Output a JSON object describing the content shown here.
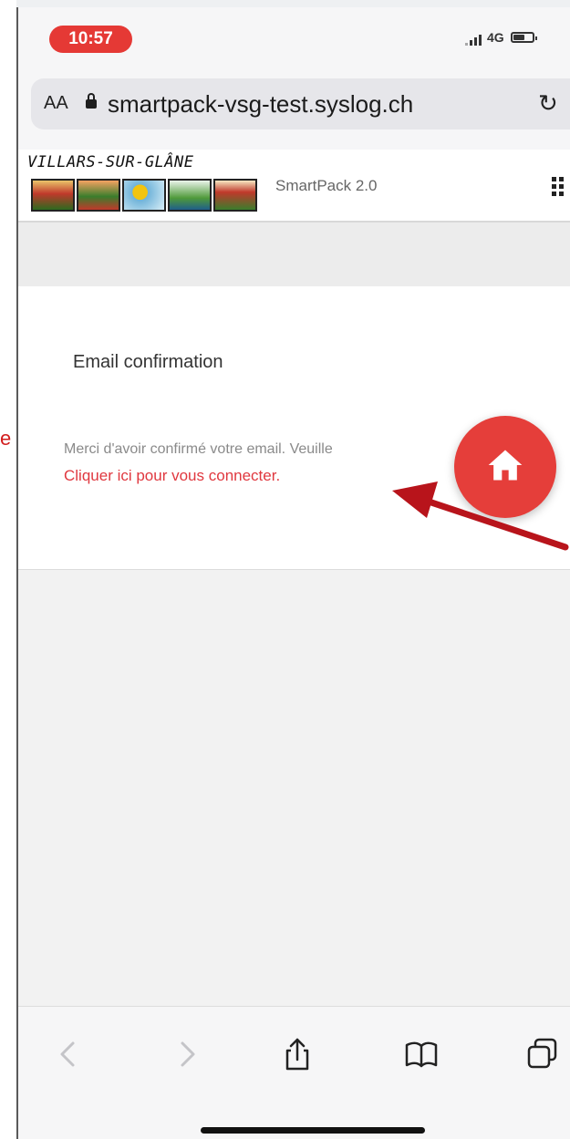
{
  "status_bar": {
    "time": "10:57",
    "network": "4G"
  },
  "address_bar": {
    "text_size_label": "AA",
    "url": "smartpack-vsg-test.syslog.ch"
  },
  "site_header": {
    "logo_text": "VILLARS-SUR-GLÂNE",
    "brand": "SmartPack 2.0"
  },
  "card": {
    "title": "Email confirmation",
    "message": "Merci d'avoir confirmé votre email. Veuille",
    "login_link": "Cliquer ici pour vous connecter."
  },
  "margin_glyph": "e",
  "colors": {
    "accent_red": "#e53e3a",
    "link_red": "#e0383f",
    "annotation_arrow": "#b8141b"
  },
  "icons": {
    "reload": "reload-icon",
    "lock": "lock-icon",
    "menu": "grid-menu-icon",
    "fab": "home-icon",
    "toolbar": [
      "back-icon",
      "forward-icon",
      "share-icon",
      "bookmarks-icon",
      "tabs-icon"
    ]
  }
}
